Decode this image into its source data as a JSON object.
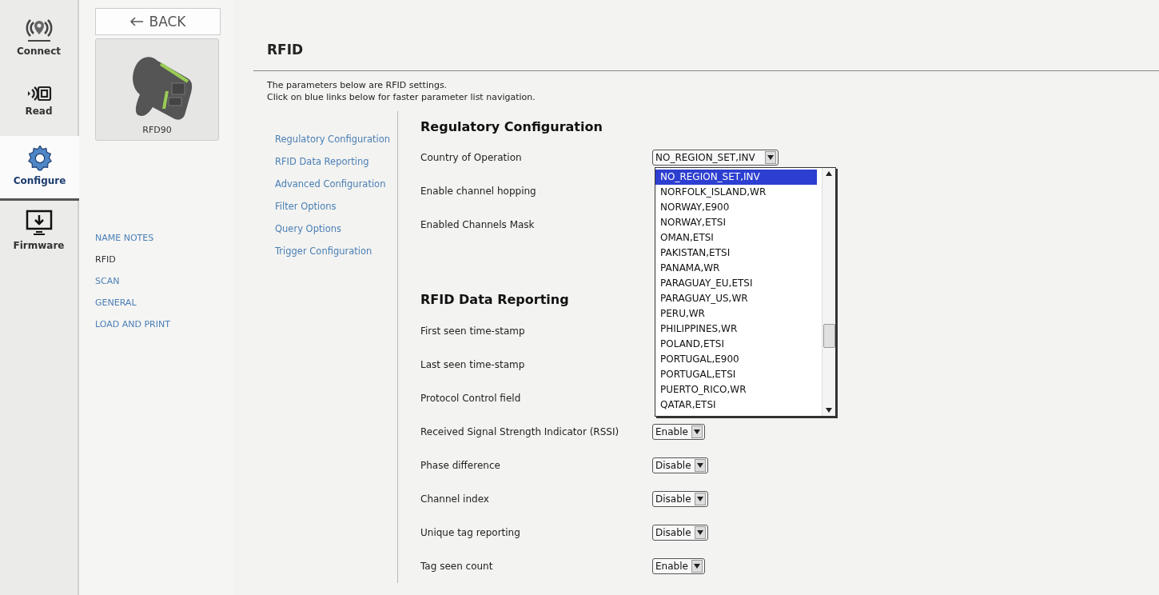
{
  "nav_rail": [
    {
      "label": "Connect",
      "kind": "connect",
      "selected": false
    },
    {
      "label": "Read",
      "kind": "read",
      "selected": false
    },
    {
      "label": "Configure",
      "kind": "configure",
      "selected": true
    },
    {
      "label": "Firmware",
      "kind": "firmware",
      "selected": false
    }
  ],
  "back_button": {
    "label": "BACK"
  },
  "device": {
    "name": "RFD90"
  },
  "submenu": [
    {
      "label": "NAME NOTES",
      "selected": false
    },
    {
      "label": "RFID",
      "selected": true
    },
    {
      "label": "SCAN",
      "selected": false
    },
    {
      "label": "GENERAL",
      "selected": false
    },
    {
      "label": "LOAD AND PRINT",
      "selected": false
    }
  ],
  "page": {
    "title": "RFID",
    "description": [
      "The parameters below are RFID settings.",
      "Click on blue links below for faster parameter list navigation."
    ]
  },
  "section_links": [
    "Regulatory Configuration",
    "RFID Data Reporting",
    "Advanced Configuration",
    "Filter Options",
    "Query Options",
    "Trigger Configuration"
  ],
  "sections": [
    {
      "title": "Regulatory Configuration",
      "rows": [
        {
          "label": "Country of Operation",
          "value": "NO_REGION_SET,INV",
          "open_list": [
            {
              "label": "NO_REGION_SET,INV",
              "selected": true
            },
            {
              "label": "NORFOLK_ISLAND,WR",
              "selected": false
            },
            {
              "label": "NORWAY,E900",
              "selected": false
            },
            {
              "label": "NORWAY,ETSI",
              "selected": false
            },
            {
              "label": "OMAN,ETSI",
              "selected": false
            },
            {
              "label": "PAKISTAN,ETSI",
              "selected": false
            },
            {
              "label": "PANAMA,WR",
              "selected": false
            },
            {
              "label": "PARAGUAY_EU,ETSI",
              "selected": false
            },
            {
              "label": "PARAGUAY_US,WR",
              "selected": false
            },
            {
              "label": "PERU,WR",
              "selected": false
            },
            {
              "label": "PHILIPPINES,WR",
              "selected": false
            },
            {
              "label": "POLAND,ETSI",
              "selected": false
            },
            {
              "label": "PORTUGAL,E900",
              "selected": false
            },
            {
              "label": "PORTUGAL,ETSI",
              "selected": false
            },
            {
              "label": "PUERTO_RICO,WR",
              "selected": false
            },
            {
              "label": "QATAR,ETSI",
              "selected": false
            }
          ]
        },
        {
          "label": "Enable channel hopping"
        },
        {
          "label": "Enabled Channels Mask"
        }
      ]
    },
    {
      "title": "RFID Data Reporting",
      "rows": [
        {
          "label": "First seen time-stamp"
        },
        {
          "label": "Last seen time-stamp"
        },
        {
          "label": "Protocol Control field"
        },
        {
          "label": "Received Signal Strength Indicator (RSSI)",
          "value": "Enable"
        },
        {
          "label": "Phase difference",
          "value": "Disable"
        },
        {
          "label": "Channel index",
          "value": "Disable"
        },
        {
          "label": "Unique tag reporting",
          "value": "Disable"
        },
        {
          "label": "Tag seen count",
          "value": "Enable"
        }
      ]
    }
  ]
}
